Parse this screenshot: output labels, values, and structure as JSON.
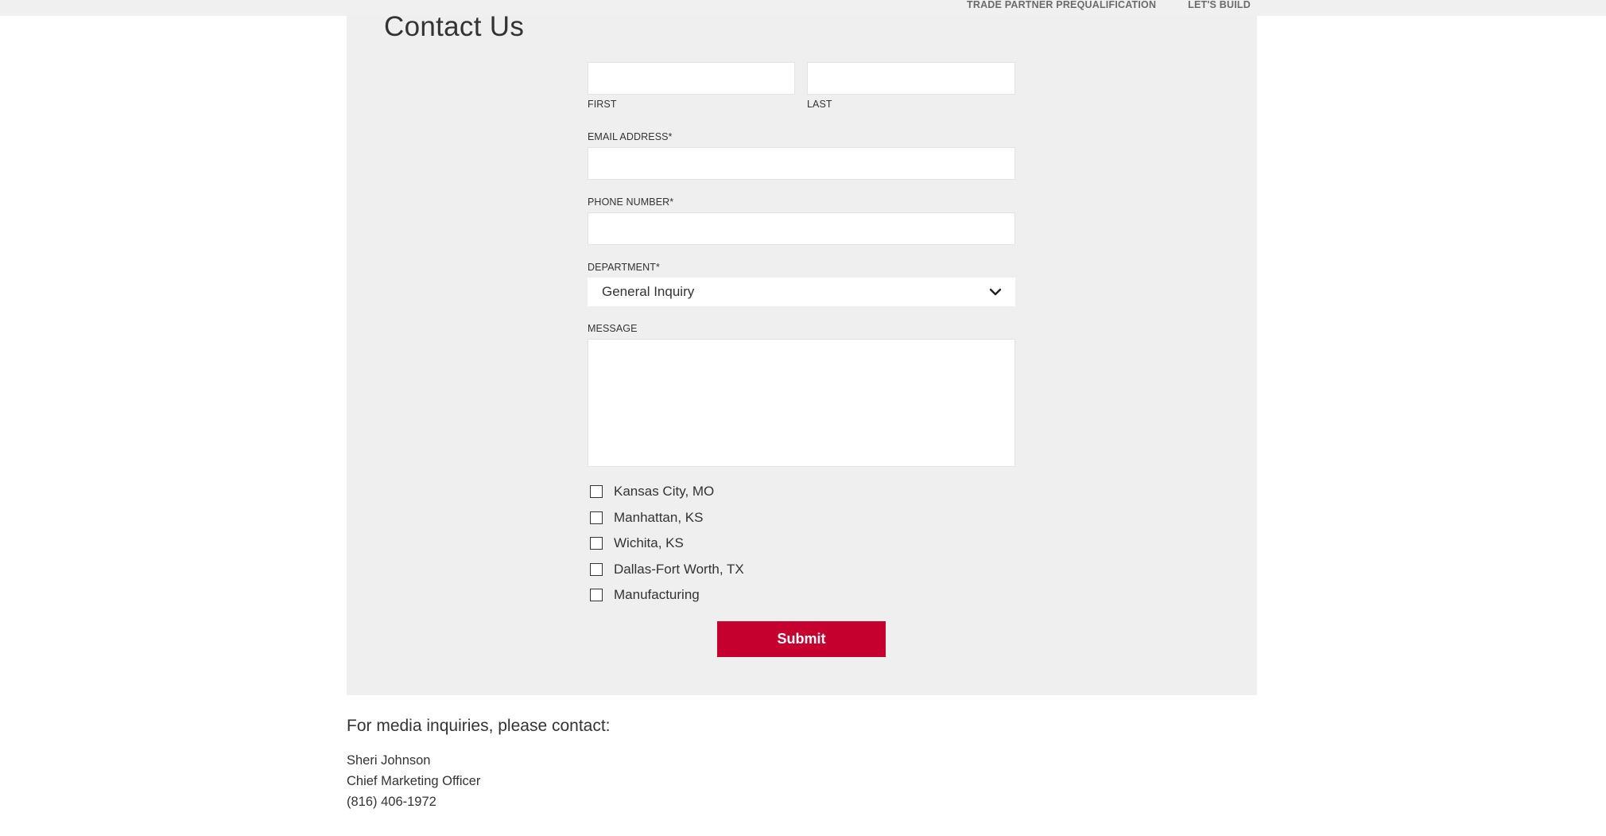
{
  "nav": {
    "items": [
      {
        "label": "TRADE PARTNER PREQUALIFICATION"
      },
      {
        "label": "LET'S BUILD"
      }
    ]
  },
  "page": {
    "title": "Contact Us"
  },
  "form": {
    "name": {
      "first": {
        "value": "",
        "label": "FIRST"
      },
      "last": {
        "value": "",
        "label": "LAST"
      }
    },
    "email": {
      "label": "EMAIL ADDRESS*",
      "value": ""
    },
    "phone": {
      "label": "PHONE NUMBER*",
      "value": ""
    },
    "department": {
      "label": "DEPARTMENT*",
      "selected": "General Inquiry"
    },
    "message": {
      "label": "MESSAGE",
      "value": ""
    },
    "locations": [
      {
        "label": "Kansas City, MO",
        "checked": false
      },
      {
        "label": "Manhattan, KS",
        "checked": false
      },
      {
        "label": "Wichita, KS",
        "checked": false
      },
      {
        "label": "Dallas-Fort Worth, TX",
        "checked": false
      },
      {
        "label": "Manufacturing",
        "checked": false
      }
    ],
    "submit_label": "Submit"
  },
  "media": {
    "heading": "For media inquiries, please contact:",
    "name": "Sheri Johnson",
    "title": "Chief Marketing Officer",
    "phone": "(816) 406-1972"
  },
  "colors": {
    "accent": "#c5002e",
    "panel_bg": "#efefef",
    "text": "#333333"
  }
}
